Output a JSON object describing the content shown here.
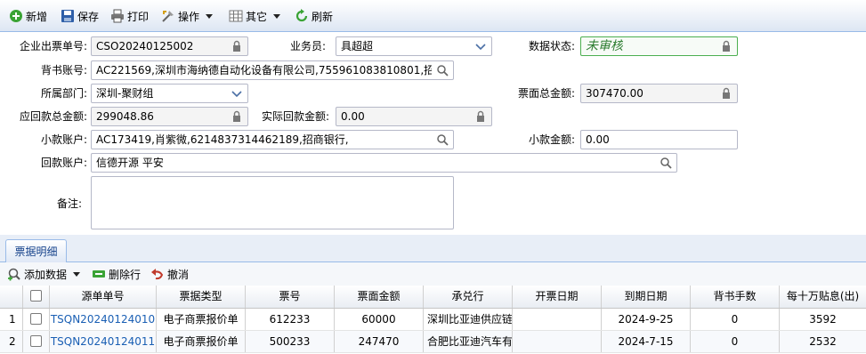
{
  "toolbar": {
    "new_label": "新增",
    "save_label": "保存",
    "print_label": "打印",
    "operate_label": "操作",
    "other_label": "其它",
    "refresh_label": "刷新"
  },
  "form": {
    "order_no": {
      "label": "企业出票单号:",
      "value": "CSO20240125002"
    },
    "salesman": {
      "label": "业务员:",
      "value": "具超超"
    },
    "data_status": {
      "label": "数据状态:",
      "value": "未审核"
    },
    "endorse_account": {
      "label": "背书账号:",
      "value": "AC221569,深圳市海纳德自动化设备有限公司,755961083810801,招商银"
    },
    "department": {
      "label": "所属部门:",
      "value": "深圳-聚财组"
    },
    "face_total": {
      "label": "票面总金额:",
      "value": "307470.00"
    },
    "receivable_total": {
      "label": "应回款总金额:",
      "value": "299048.86"
    },
    "actual_received": {
      "label": "实际回款金额:",
      "value": "0.00"
    },
    "small_account": {
      "label": "小款账户:",
      "value": "AC173419,肖紫微,6214837314462189,招商银行,"
    },
    "small_amount": {
      "label": "小款金额:",
      "value": "0.00"
    },
    "return_account": {
      "label": "回款账户:",
      "value": "信德开源 平安"
    },
    "remark": {
      "label": "备注:",
      "value": ""
    }
  },
  "tabs": [
    {
      "label": "票据明细"
    }
  ],
  "grid_toolbar": {
    "add_label": "添加数据",
    "delete_label": "删除行",
    "undo_label": "撤消"
  },
  "grid": {
    "columns": [
      "源单单号",
      "票据类型",
      "票号",
      "票面金额",
      "承兑行",
      "开票日期",
      "到期日期",
      "背书手数",
      "每十万贴息(出)"
    ],
    "rows": [
      {
        "index": "1",
        "source_no": "TSQN20240124010",
        "type": "电子商票报价单",
        "ticket_no": "612233",
        "amount": "60000",
        "acceptor": "深圳比亚迪供应链管",
        "issue_date": "",
        "due_date": "2024-9-25",
        "endorse_count": "0",
        "discount": "3592"
      },
      {
        "index": "2",
        "source_no": "TSQN20240124011",
        "type": "电子商票报价单",
        "ticket_no": "500233",
        "amount": "247470",
        "acceptor": "合肥比亚迪汽车有限",
        "issue_date": "",
        "due_date": "2024-7-15",
        "endorse_count": "0",
        "discount": "2532"
      }
    ]
  },
  "colors": {
    "accent": "#15428b",
    "status_green": "#2e7d32",
    "link": "#1a5fb4"
  }
}
